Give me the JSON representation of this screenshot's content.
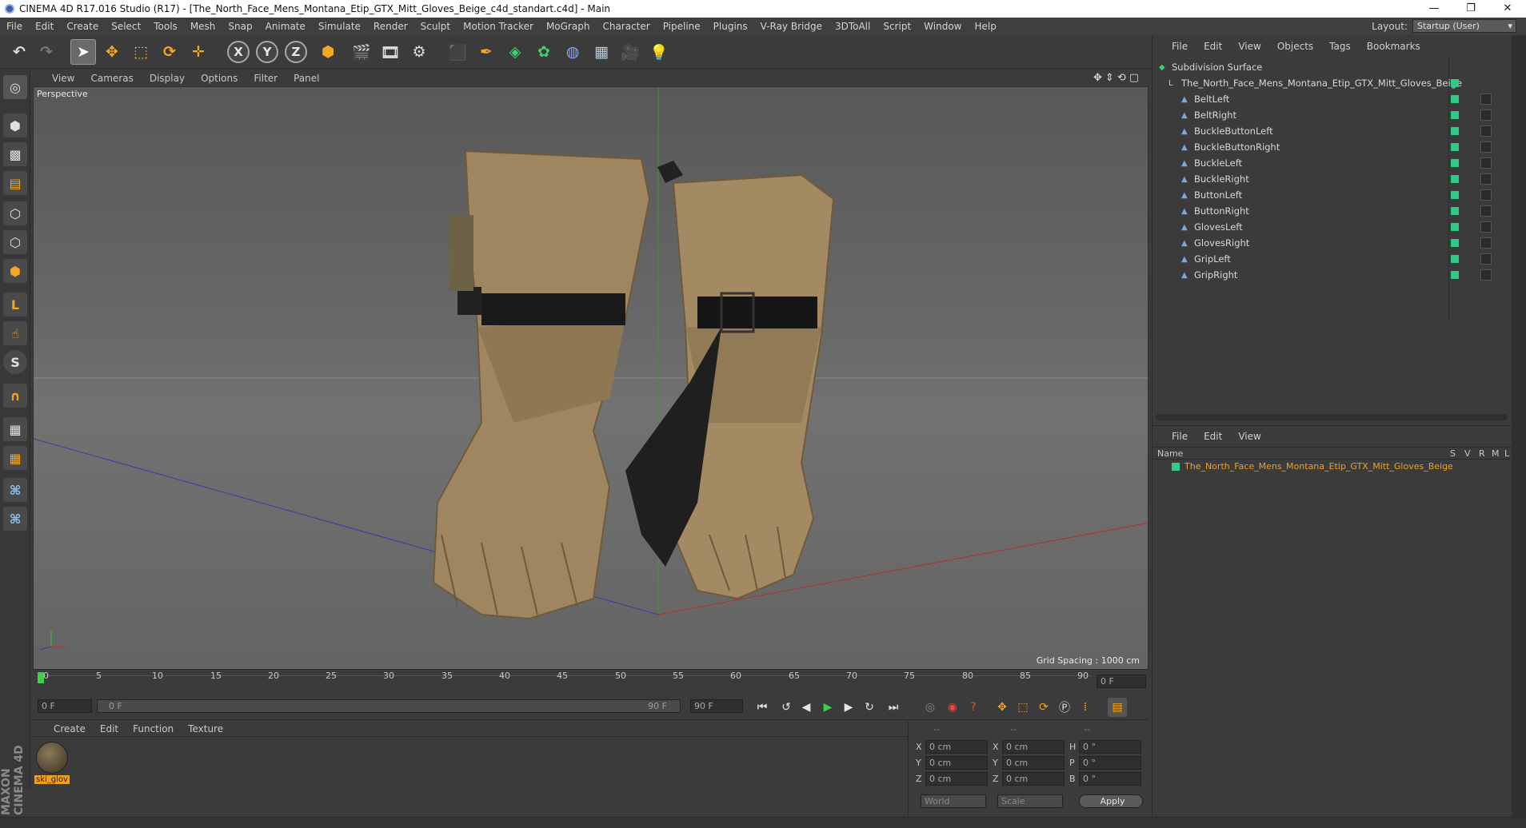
{
  "window": {
    "title": "CINEMA 4D R17.016 Studio (R17) - [The_North_Face_Mens_Montana_Etip_GTX_Mitt_Gloves_Beige_c4d_standart.c4d] - Main",
    "controls": [
      "—",
      "❐",
      "✕"
    ]
  },
  "menubar": [
    "File",
    "Edit",
    "Create",
    "Select",
    "Tools",
    "Mesh",
    "Snap",
    "Animate",
    "Simulate",
    "Render",
    "Sculpt",
    "Motion Tracker",
    "MoGraph",
    "Character",
    "Pipeline",
    "Plugins",
    "V-Ray Bridge",
    "3DToAll",
    "Script",
    "Window",
    "Help"
  ],
  "layout": {
    "label": "Layout:",
    "value": "Startup (User)"
  },
  "viewport": {
    "menu": [
      "View",
      "Cameras",
      "Display",
      "Options",
      "Filter",
      "Panel"
    ],
    "label": "Perspective",
    "grid_spacing": "Grid Spacing : 1000 cm"
  },
  "timeline": {
    "ticks": [
      "0",
      "5",
      "10",
      "15",
      "20",
      "25",
      "30",
      "35",
      "40",
      "45",
      "50",
      "55",
      "60",
      "65",
      "70",
      "75",
      "80",
      "85",
      "90"
    ],
    "current_frame": "0 F",
    "start_field": "0 F",
    "range_start": "0 F",
    "range_end": "90 F",
    "end_field": "90 F"
  },
  "material_panel": {
    "menu": [
      "Create",
      "Edit",
      "Function",
      "Texture"
    ],
    "materials": [
      {
        "name": "ski_glov"
      }
    ]
  },
  "coordinates": {
    "headers": [
      "--",
      "--",
      "--"
    ],
    "rows": [
      {
        "a": "X",
        "v1": "0 cm",
        "b": "X",
        "v2": "0 cm",
        "c": "H",
        "v3": "0 °"
      },
      {
        "a": "Y",
        "v1": "0 cm",
        "b": "Y",
        "v2": "0 cm",
        "c": "P",
        "v3": "0 °"
      },
      {
        "a": "Z",
        "v1": "0 cm",
        "b": "Z",
        "v2": "0 cm",
        "c": "B",
        "v3": "0 °"
      }
    ],
    "mode": "World",
    "scale": "Scale",
    "apply": "Apply"
  },
  "object_manager": {
    "menu": [
      "File",
      "Edit",
      "View",
      "Objects",
      "Tags",
      "Bookmarks"
    ],
    "root": "Subdivision Surface",
    "group": "The_North_Face_Mens_Montana_Etip_GTX_Mitt_Gloves_Beige",
    "children": [
      "BeltLeft",
      "BeltRight",
      "BuckleButtonLeft",
      "BuckleButtonRight",
      "BuckleLeft",
      "BuckleRight",
      "ButtonLeft",
      "ButtonRight",
      "GlovesLeft",
      "GlovesRight",
      "GripLeft",
      "GripRight"
    ]
  },
  "attribute_manager": {
    "menu": [
      "File",
      "Edit",
      "View"
    ],
    "col_name": "Name",
    "cols": [
      "S",
      "V",
      "R",
      "M",
      "L"
    ],
    "item": "The_North_Face_Mens_Montana_Etip_GTX_Mitt_Gloves_Beige"
  },
  "branding": "MAXON CINEMA 4D",
  "colors": {
    "accent": "#2ecc86",
    "selected_text": "#f0a020",
    "play": "#3fd04a"
  }
}
